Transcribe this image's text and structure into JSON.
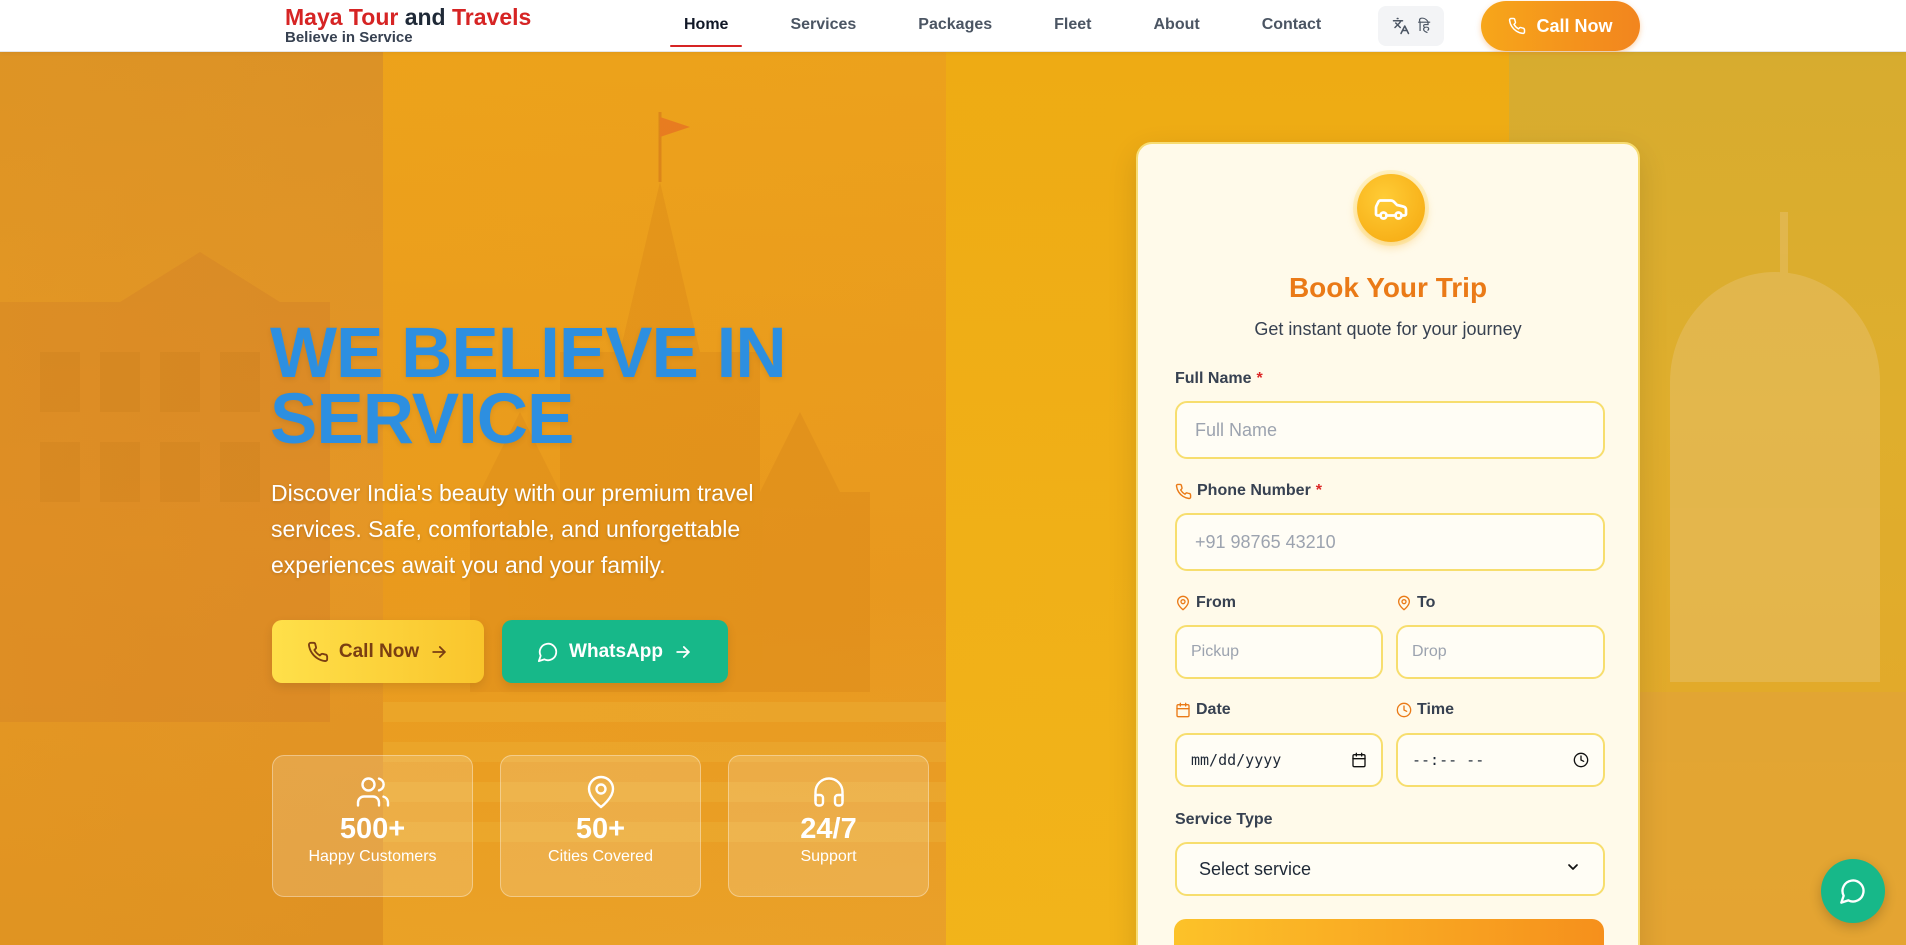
{
  "brand": {
    "name_part1": "Maya Tour",
    "name_part2": "and",
    "name_part3": "Travels",
    "tagline": "Believe in Service"
  },
  "nav": {
    "items": [
      {
        "label": "Home",
        "active": true
      },
      {
        "label": "Services",
        "active": false
      },
      {
        "label": "Packages",
        "active": false
      },
      {
        "label": "Fleet",
        "active": false
      },
      {
        "label": "About",
        "active": false
      },
      {
        "label": "Contact",
        "active": false
      }
    ],
    "lang_glyph": "हि",
    "lang_icon": "translate-icon",
    "call_label": "Call Now"
  },
  "hero": {
    "headline_line1": "WE BELIEVE IN",
    "headline_line2": "SERVICE",
    "subtext": "Discover India's beauty with our premium travel services. Safe, comfortable, and unforgettable experiences await you and your family.",
    "call_label": "Call Now",
    "whatsapp_label": "WhatsApp",
    "stats": [
      {
        "icon": "users-icon",
        "value": "500+",
        "label": "Happy Customers"
      },
      {
        "icon": "map-pin-icon",
        "value": "50+",
        "label": "Cities Covered"
      },
      {
        "icon": "headphones-icon",
        "value": "24/7",
        "label": "Support"
      }
    ]
  },
  "booking": {
    "title": "Book Your Trip",
    "subtitle": "Get instant quote for your journey",
    "full_name_label": "Full Name",
    "full_name_placeholder": "Full Name",
    "phone_label": "Phone Number",
    "phone_placeholder": "+91 98765 43210",
    "from_label": "From",
    "from_placeholder": "Pickup",
    "to_label": "To",
    "to_placeholder": "Drop",
    "date_label": "Date",
    "date_value": "mm/dd/yyyy",
    "time_label": "Time",
    "time_value": "--:-- --",
    "service_label": "Service Type",
    "service_value": "Select service",
    "required_mark": "*"
  },
  "colors": {
    "brand_red": "#d62424",
    "accent_orange": "#f2851e",
    "headline_blue": "#2d8fe0",
    "whatsapp_green": "#17b889",
    "card_title_orange": "#ea7a17"
  }
}
